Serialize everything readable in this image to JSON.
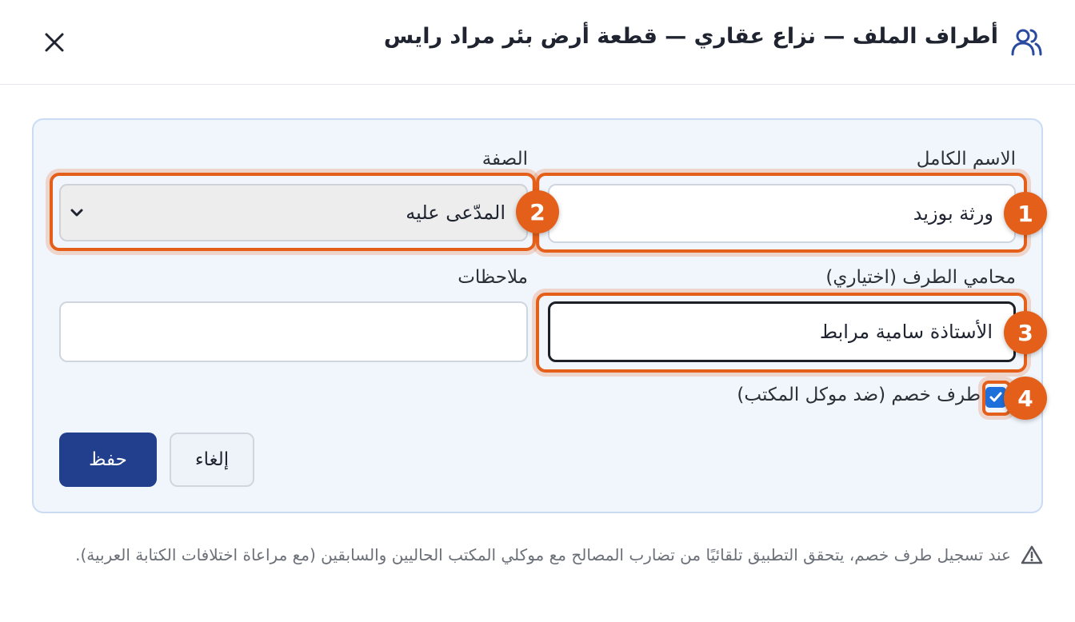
{
  "dialog": {
    "title": "أطراف الملف — نزاع عقاري — قطعة أرض بئر مراد رايس",
    "title_icon": "users-icon",
    "close_icon": "close-icon"
  },
  "form": {
    "full_name": {
      "label": "الاسم الكامل",
      "value": "ورثة بوزيد"
    },
    "role": {
      "label": "الصفة",
      "selected": "المدّعى عليه"
    },
    "lawyer": {
      "label": "محامي الطرف (اختياري)",
      "value": "الأستاذة سامية مرابط"
    },
    "notes": {
      "label": "ملاحظات",
      "value": ""
    },
    "opposing": {
      "label": "طرف خصم (ضد موكل المكتب)",
      "checked": true
    },
    "save_label": "حفظ",
    "cancel_label": "إلغاء"
  },
  "annotations": [
    "1",
    "2",
    "3",
    "4"
  ],
  "note": {
    "icon": "warning-icon",
    "text": "عند تسجيل طرف خصم، يتحقق التطبيق تلقائيًا من تضارب المصالح مع موكلي المكتب الحاليين والسابقين (مع مراعاة اختلافات الكتابة العربية)."
  },
  "colors": {
    "accent": "#e4601a",
    "primary": "#213f8c",
    "checkbox": "#1e6fd9",
    "panel_bg": "#f1f6fd"
  }
}
